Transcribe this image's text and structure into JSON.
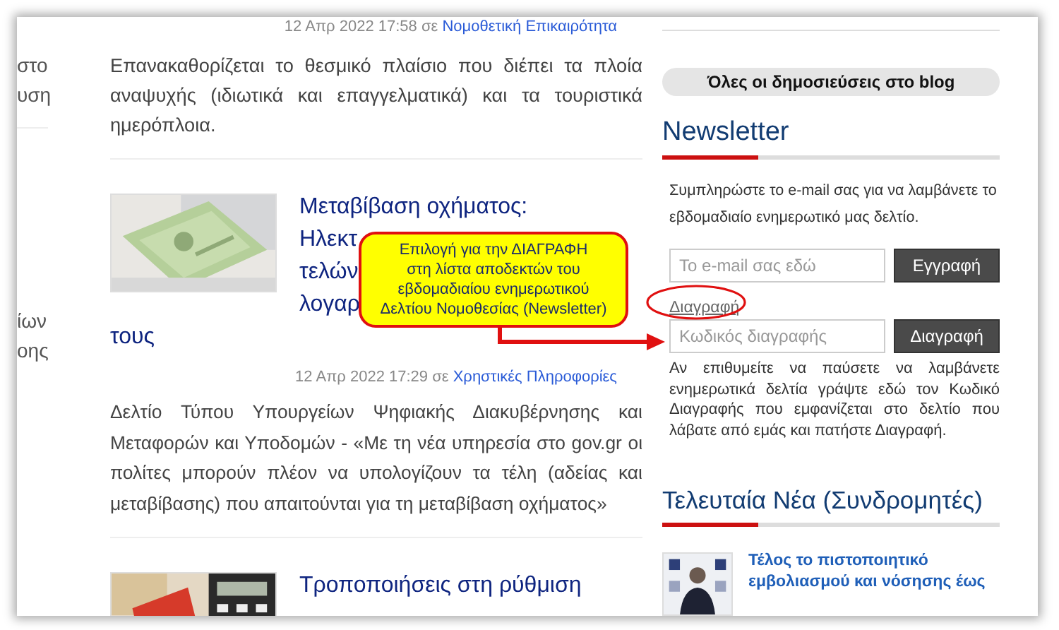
{
  "left_strip": [
    {
      "lines": [
        "στο",
        "υση"
      ]
    },
    {
      "lines": [
        "ίων",
        "οης"
      ]
    }
  ],
  "articles": [
    {
      "date": "12 Απρ 2022 17:58 σε",
      "category": "Νομοθετική Επικαιρότητα",
      "excerpt": "Επανακαθορίζεται το θεσμικό πλαίσιο που διέπει τα πλοία αναψυχής (ιδιωτικά και επαγγελματικά) και τα τουριστικά ημερόπλοια."
    },
    {
      "thumbnail": {
        "kind": "picture"
      },
      "title_lines": [
        "Μεταβίβαση οχήματος:",
        "Ηλεκτ",
        "τελών",
        "λογαρ"
      ],
      "title_tail": "τους",
      "date": "12 Απρ 2022 17:29 σε",
      "category": "Χρηστικές Πληροφορίες",
      "excerpt": "Δελτίο Τύπου Υπουργείων Ψηφιακής Διακυβέρνησης και Μεταφορών και Υποδομών - «Με τη νέα υπηρεσία στο gov.gr οι πολίτες μπορούν πλέον να υπολογίζουν τα τέλη (αδείας και μεταβίβασης) που απαιτούνται για τη μεταβίβαση οχήματος»"
    },
    {
      "thumbnail": {
        "kind": "picture"
      },
      "title_lines": [
        "Τροποποιήσεις στη ρύθμιση"
      ]
    }
  ],
  "sidebar": {
    "blog_button": "Όλες οι δημοσιεύσεις στο blog",
    "newsletter": {
      "title": "Newsletter",
      "intro": "Συμπληρώστε το e-mail σας για να λαμβάνετε το εβδομαδιαίο ενημερωτικό μας δελτίο.",
      "email": {
        "placeholder": "Το e-mail σας εδώ"
      },
      "subscribe_button": "Εγγραφή",
      "unsubscribe_link": "Διαγραφή",
      "code": {
        "placeholder": "Κωδικός διαγραφής"
      },
      "unsubscribe_button": "Διαγραφή",
      "help": "Αν επιθυμείτε να παύσετε να λαμβάνετε ενημερωτικά δελτία γράψτε εδώ τον Κωδικό Διαγραφής που εμφανίζεται στο δελτίο που λάβατε από εμάς και πατήστε Διαγραφή."
    },
    "latest": {
      "title": "Τελευταία Νέα (Συνδρομητές)",
      "items": [
        {
          "thumbnail": {
            "kind": "picture"
          },
          "title": "Τέλος το πιστοποιητικό εμβολιασμού και νόσησης έως"
        }
      ]
    }
  },
  "callout": {
    "lines": [
      "Επιλογή για την ΔΙΑΓΡΑΦΗ",
      "στη λίστα αποδεκτών του",
      "εβδομαδιαίου ενημερωτικού",
      "Δελτίου Νομοθεσίας (Newsletter)"
    ]
  }
}
